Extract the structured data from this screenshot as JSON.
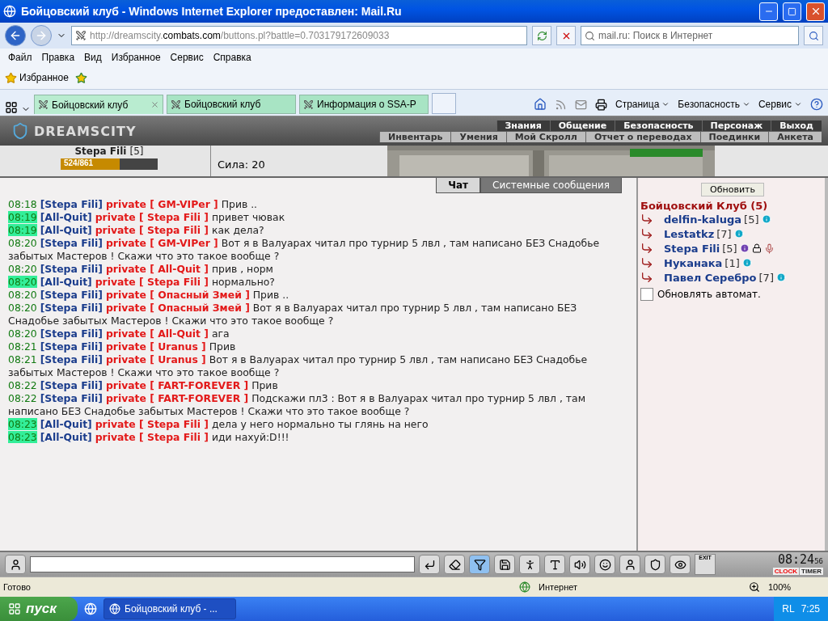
{
  "window": {
    "title": "Бойцовский клуб - Windows Internet Explorer предоставлен: Mail.Ru"
  },
  "address": {
    "url_prefix": "http://dreamscity.",
    "url_domain": "combats.com",
    "url_rest": "/buttons.pl?battle=0.703179172609033"
  },
  "search": {
    "placeholder": "mail.ru: Поиск в Интернет"
  },
  "menu": [
    "Файл",
    "Правка",
    "Вид",
    "Избранное",
    "Сервис",
    "Справка"
  ],
  "favorites": {
    "label": "Избранное"
  },
  "tabs": [
    {
      "label": "Бойцовский клуб",
      "selected": true
    },
    {
      "label": "Бойцовский клуб",
      "selected": false
    },
    {
      "label": "Информация о SSA-P",
      "selected": false
    }
  ],
  "command_bar": [
    "Страница",
    "Безопасность",
    "Сервис"
  ],
  "game": {
    "logo": "DREAMSCITY",
    "nav_top": [
      "Знания",
      "Общение",
      "Безопасность",
      "Персонаж",
      "Выход"
    ],
    "nav_bottom": [
      "Инвентарь",
      "Умения",
      "Мой Скролл",
      "Отчет о переводах",
      "Поединки",
      "Анкета"
    ],
    "character": {
      "name": "Stepa Fili",
      "level_text": "[5]",
      "hp": "524/861",
      "level": 0.61,
      "stat": "Сила: 20"
    }
  },
  "chat_tabs": [
    {
      "label": "Чат",
      "selected": true
    },
    {
      "label": "Системные сообщения",
      "selected": false
    }
  ],
  "messages": [
    {
      "time": "08:18",
      "highlighted": false,
      "sender": "[Stepa Fili]",
      "target": "private [ GM-VIPer ]",
      "text": "Прив .."
    },
    {
      "time": "08:19",
      "highlighted": true,
      "sender": "[All-Quit]",
      "target": "private [ Stepa Fili ]",
      "text": "привет чювак"
    },
    {
      "time": "08:19",
      "highlighted": true,
      "sender": "[All-Quit]",
      "target": "private [ Stepa Fili ]",
      "text": "как дела?"
    },
    {
      "time": "08:20",
      "highlighted": false,
      "sender": "[Stepa Fili]",
      "target": "private [ GM-VIPer ]",
      "text": "Вот я в Валуарах читал про турнир 5 лвл , там написано БЕЗ Снадобье забытых Мастеров ! Скажи что это такое вообще ?"
    },
    {
      "time": "08:20",
      "highlighted": false,
      "sender": "[Stepa Fili]",
      "target": "private [ All-Quit ]",
      "text": "прив , норм"
    },
    {
      "time": "08:20",
      "highlighted": true,
      "sender": "[All-Quit]",
      "target": "private [ Stepa Fili ]",
      "text": "нормально?"
    },
    {
      "time": "08:20",
      "highlighted": false,
      "sender": "[Stepa Fili]",
      "target": "private [ Опасный Змей ]",
      "text": "Прив .."
    },
    {
      "time": "08:20",
      "highlighted": false,
      "sender": "[Stepa Fili]",
      "target": "private [ Опасный Змей ]",
      "text": "Вот я в Валуарах читал про турнир 5 лвл , там написано БЕЗ Снадобье забытых Мастеров ! Скажи что это такое вообще ?"
    },
    {
      "time": "08:20",
      "highlighted": false,
      "sender": "[Stepa Fili]",
      "target": "private [ All-Quit ]",
      "text": "ага"
    },
    {
      "time": "08:21",
      "highlighted": false,
      "sender": "[Stepa Fili]",
      "target": "private [ Uranus ]",
      "text": "Прив"
    },
    {
      "time": "08:21",
      "highlighted": false,
      "sender": "[Stepa Fili]",
      "target": "private [ Uranus ]",
      "text": "Вот я в Валуарах читал про турнир 5 лвл , там написано БЕЗ Снадобье забытых Мастеров ! Скажи что это такое вообще ?"
    },
    {
      "time": "08:22",
      "highlighted": false,
      "sender": "[Stepa Fili]",
      "target": "private [ FART-FOREVER ]",
      "text": "Прив"
    },
    {
      "time": "08:22",
      "highlighted": false,
      "sender": "[Stepa Fili]",
      "target": "private [ FART-FOREVER ]",
      "text": "Подскажи пл3 : Вот я в Валуарах читал про турнир 5 лвл , там написано БЕЗ Снадобье забытых Мастеров ! Скажи что это такое вообще ?"
    },
    {
      "time": "08:23",
      "highlighted": true,
      "sender": "[All-Quit]",
      "target": "private [ Stepa Fili ]",
      "text": "дела у него нормально ты глянь на него"
    },
    {
      "time": "08:23",
      "highlighted": true,
      "sender": "[All-Quit]",
      "target": "private [ Stepa Fili ]",
      "text": "иди нахуй:D!!!"
    }
  ],
  "online": {
    "refresh": "Обновить",
    "title": "Бойцовский Клуб (5)",
    "users": [
      {
        "name": "delfin-kaluga",
        "level_text": "[5]",
        "muted": false
      },
      {
        "name": "Lestatkz",
        "level_text": "[7]",
        "muted": false
      },
      {
        "name": "Stepa Fili",
        "level_text": "[5]",
        "muted": true
      },
      {
        "name": "Нуканака",
        "level_text": "[1]",
        "muted": false
      },
      {
        "name": "Павел Серебро",
        "level_text": "[7]",
        "muted": false
      }
    ],
    "auto_refresh": {
      "label": "Обновлять автомат.",
      "checked": false
    }
  },
  "toolbar": [
    {
      "kind": "eraser",
      "selected": false
    },
    {
      "kind": "filter",
      "selected": true
    },
    {
      "kind": "save",
      "selected": false
    },
    {
      "kind": "run",
      "selected": false
    },
    {
      "kind": "translit",
      "selected": false
    },
    {
      "kind": "sound",
      "selected": false
    },
    {
      "kind": "smile",
      "selected": false
    },
    {
      "kind": "head",
      "selected": false
    }
  ],
  "clock": {
    "exit": "EXIT",
    "time": "08:24",
    "seconds": "56",
    "clock_label": "CLOCK",
    "timer_label": "TIMER"
  },
  "status_bar": {
    "text": "Готово",
    "zone": "Интернет",
    "zoom": "100%"
  },
  "taskbar": {
    "start": "пуск",
    "task": "Бойцовский клуб - ...",
    "lang": "RL",
    "time": "7:25"
  }
}
